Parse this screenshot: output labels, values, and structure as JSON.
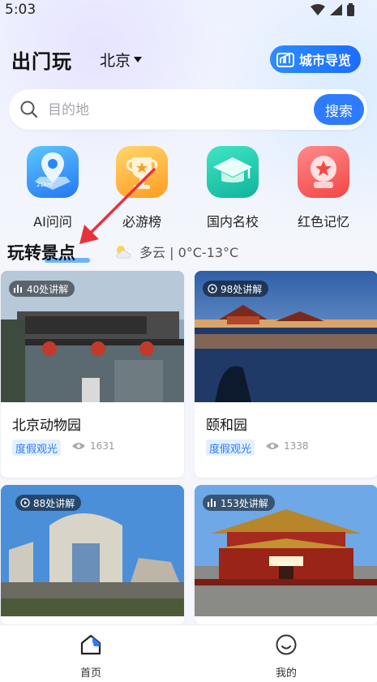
{
  "status": {
    "time": "5:03"
  },
  "header": {
    "logo": "出门玩",
    "city": "北京",
    "city_guide_label": "城市导览"
  },
  "search": {
    "placeholder": "目的地",
    "button_label": "搜索"
  },
  "categories": [
    {
      "label": "AI问问",
      "icon": "ai-map-pin-icon"
    },
    {
      "label": "必游榜",
      "icon": "trophy-icon"
    },
    {
      "label": "国内名校",
      "icon": "graduation-cap-icon"
    },
    {
      "label": "红色记忆",
      "icon": "red-star-icon"
    }
  ],
  "section": {
    "title": "玩转景点"
  },
  "weather": {
    "text": "多云 | 0°C-13°C",
    "icon": "partly-cloudy-icon"
  },
  "spots": [
    {
      "name": "北京动物园",
      "badge": "40处讲解",
      "badge_icon": "bars-icon",
      "tag": "度假观光",
      "views": "1631"
    },
    {
      "name": "颐和园",
      "badge": "98处讲解",
      "badge_icon": "play-icon",
      "tag": "度假观光",
      "views": "1338"
    },
    {
      "name": "",
      "badge": "88处讲解",
      "badge_icon": "play-icon"
    },
    {
      "name": "",
      "badge": "153处讲解",
      "badge_icon": "bars-icon"
    }
  ],
  "tabbar": {
    "home_label": "首页",
    "mine_label": "我的"
  },
  "colors": {
    "accent": "#2e7bff",
    "tag_bg": "#e3f0ff"
  }
}
